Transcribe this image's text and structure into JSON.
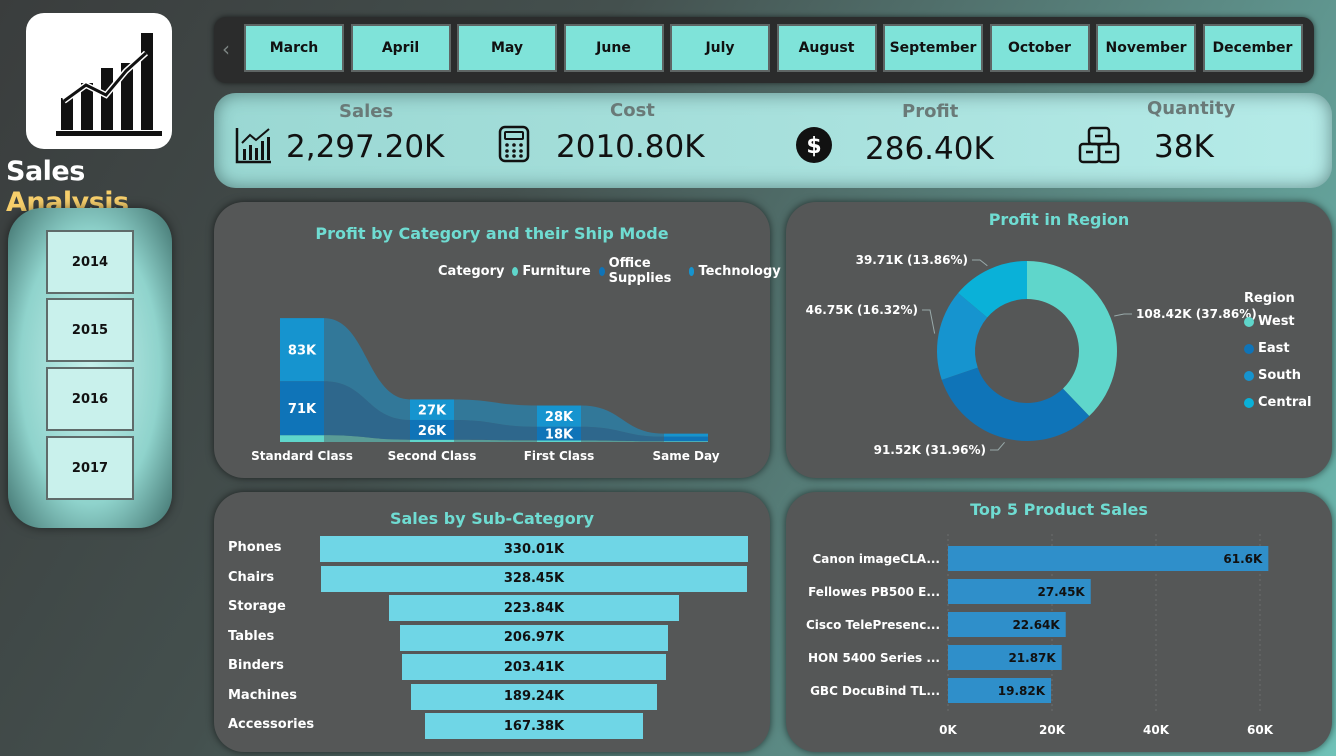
{
  "brand": {
    "title_main": "Sales",
    "title_accent": "Analysis"
  },
  "years": [
    "2014",
    "2015",
    "2016",
    "2017"
  ],
  "months": [
    "March",
    "April",
    "May",
    "June",
    "July",
    "August",
    "September",
    "October",
    "November",
    "December"
  ],
  "kpis": {
    "sales": {
      "label": "Sales",
      "value": "2,297.20K",
      "icon": "chart-icon"
    },
    "cost": {
      "label": "Cost",
      "value": "2010.80K",
      "icon": "calculator-icon"
    },
    "profit": {
      "label": "Profit",
      "value": "286.40K",
      "icon": "dollar-icon"
    },
    "quantity": {
      "label": "Quantity",
      "value": "38K",
      "icon": "boxes-icon"
    }
  },
  "colors": {
    "accent": "#6fdcd2",
    "west": "#5fd6cb",
    "east": "#0f74b8",
    "south": "#1694cf",
    "central": "#0ab1d8",
    "furniture": "#5fd6cb",
    "office_supplies": "#0f74b8",
    "technology": "#1694cf",
    "subcategory_bar": "#6fd6e6",
    "product_bar": "#2f8fca"
  },
  "ship_mode_chart": {
    "title": "Profit by Category and their Ship Mode",
    "legend_title": "Category",
    "chart_data": {
      "type": "ribbon",
      "categories": [
        "Standard Class",
        "Second Class",
        "First Class",
        "Same Day"
      ],
      "series": [
        {
          "name": "Furniture",
          "values": [
            9,
            3,
            2,
            1
          ]
        },
        {
          "name": "Office Supplies",
          "values": [
            71,
            26,
            18,
            6
          ]
        },
        {
          "name": "Technology",
          "values": [
            83,
            27,
            28,
            4
          ]
        }
      ],
      "labels": [
        {
          "category": "Standard Class",
          "text": "83K"
        },
        {
          "category": "Standard Class",
          "text": "71K"
        },
        {
          "category": "Second Class",
          "text": "27K"
        },
        {
          "category": "Second Class",
          "text": "26K"
        },
        {
          "category": "First Class",
          "text": "28K"
        },
        {
          "category": "First Class",
          "text": "18K"
        }
      ]
    }
  },
  "region_chart": {
    "title": "Profit in Region",
    "legend_title": "Region",
    "chart_data": {
      "type": "pie",
      "slices": [
        {
          "name": "West",
          "value": 108.42,
          "label": "108.42K (37.86%)"
        },
        {
          "name": "East",
          "value": 91.52,
          "label": "91.52K (31.96%)"
        },
        {
          "name": "South",
          "value": 46.75,
          "label": "46.75K (16.32%)"
        },
        {
          "name": "Central",
          "value": 39.71,
          "label": "39.71K (13.86%)"
        }
      ]
    }
  },
  "subcategory_chart": {
    "title": "Sales by Sub-Category",
    "chart_data": {
      "type": "bar",
      "categories": [
        "Phones",
        "Chairs",
        "Storage",
        "Tables",
        "Binders",
        "Machines",
        "Accessories"
      ],
      "values": [
        330.01,
        328.45,
        223.84,
        206.97,
        203.41,
        189.24,
        167.38
      ],
      "labels": [
        "330.01K",
        "328.45K",
        "223.84K",
        "206.97K",
        "203.41K",
        "189.24K",
        "167.38K"
      ]
    }
  },
  "top_products_chart": {
    "title": "Top 5 Product Sales",
    "chart_data": {
      "type": "bar",
      "categories": [
        "Canon imageCLA...",
        "Fellowes PB500 E...",
        "Cisco TelePresenc...",
        "HON 5400 Series ...",
        "GBC DocuBind TL..."
      ],
      "values": [
        61.6,
        27.45,
        22.64,
        21.87,
        19.82
      ],
      "labels": [
        "61.6K",
        "27.45K",
        "22.64K",
        "21.87K",
        "19.82K"
      ],
      "xlim": [
        0,
        60
      ],
      "ticks": [
        "0K",
        "20K",
        "40K",
        "60K"
      ]
    }
  }
}
